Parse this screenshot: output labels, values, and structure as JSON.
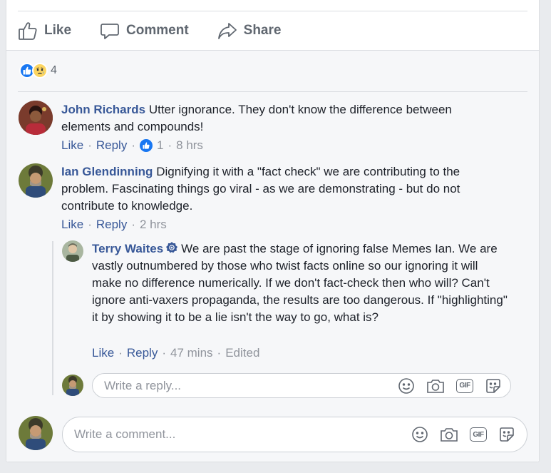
{
  "actions": {
    "like": "Like",
    "comment": "Comment",
    "share": "Share"
  },
  "reactions": {
    "count": "4",
    "types": [
      "like",
      "sad"
    ],
    "like_color": "#1877f2",
    "sad_color": "#fcd561"
  },
  "comments": [
    {
      "author": "John Richards",
      "text": "Utter ignorance. They don't know the difference between elements and compounds!",
      "like_label": "Like",
      "reply_label": "Reply",
      "like_count": "1",
      "time": "8 hrs"
    },
    {
      "author": "Ian Glendinning",
      "text": "Dignifying it with a \"fact check\" we are contributing to the problem. Fascinating things go viral - as we are demonstrating - but do not contribute to knowledge.",
      "like_label": "Like",
      "reply_label": "Reply",
      "time": "2 hrs",
      "replies": [
        {
          "author": "Terry Waites",
          "badge": "verified-badge-icon",
          "text": "We are past the stage of ignoring false Memes Ian. We are vastly outnumbered by those who twist facts online so our ignoring it will make no difference numerically. If we don't fact-check then who will? Can't ignore anti-vaxers propaganda, the results are too dangerous. If \"highlighting\" it by showing it to be a lie isn't the way to go, what is?",
          "like_label": "Like",
          "reply_label": "Reply",
          "time": "47 mins",
          "edited": "Edited"
        }
      ]
    }
  ],
  "reply_input": {
    "placeholder": "Write a reply...",
    "gif_label": "GIF"
  },
  "comment_input": {
    "placeholder": "Write a comment...",
    "gif_label": "GIF"
  },
  "colors": {
    "link": "#385898",
    "meta": "#90949c",
    "action": "#606770"
  }
}
